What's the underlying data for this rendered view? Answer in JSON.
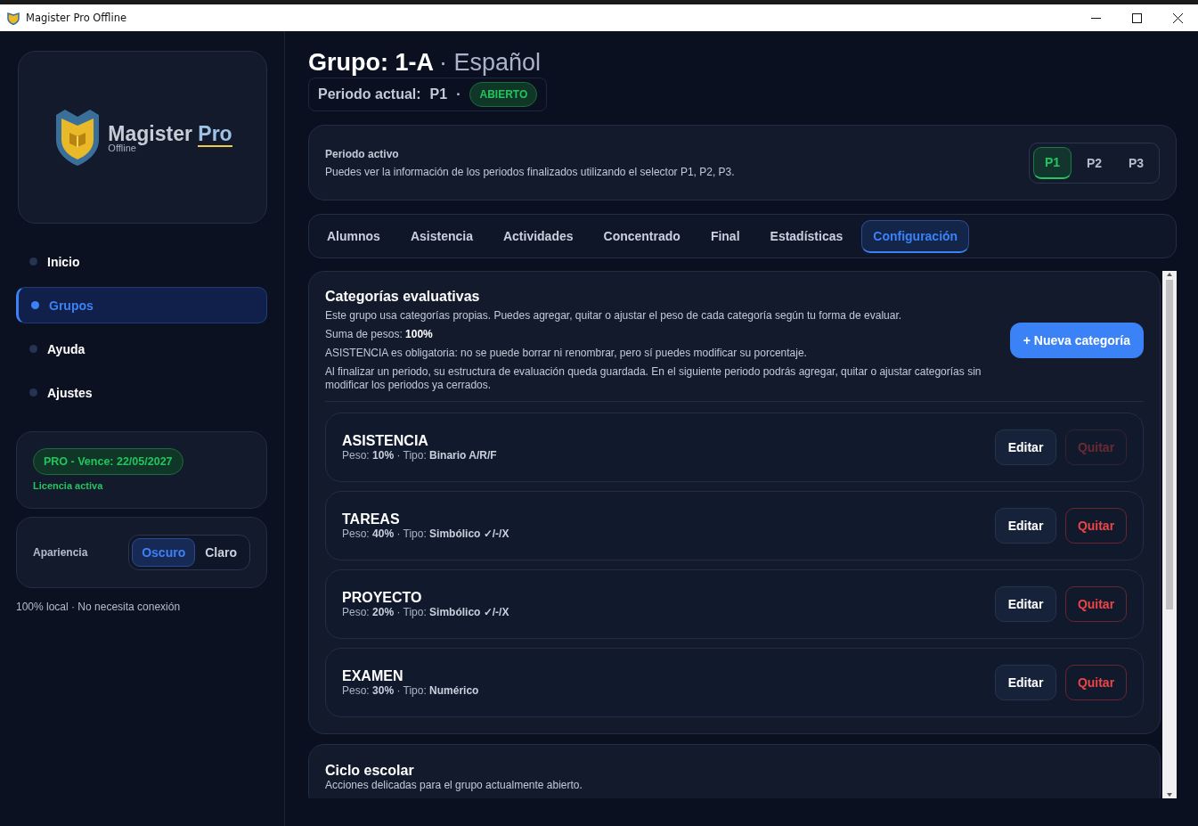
{
  "window": {
    "title": "Magister Pro Offline"
  },
  "sidebar": {
    "brand": {
      "name": "Magister",
      "accent": "Pro",
      "sub": "Offline"
    },
    "items": [
      {
        "label": "Inicio",
        "selected": false
      },
      {
        "label": "Grupos",
        "selected": true
      },
      {
        "label": "Ayuda",
        "selected": false
      },
      {
        "label": "Ajustes",
        "selected": false
      }
    ],
    "license": {
      "badge": "PRO - Vence: 22/05/2027",
      "status": "Licencia activa"
    },
    "appearance": {
      "label": "Apariencia",
      "options": [
        {
          "label": "Oscuro",
          "selected": true
        },
        {
          "label": "Claro",
          "selected": false
        }
      ]
    },
    "footer": "100% local · No necesita conexión"
  },
  "header": {
    "title": "Grupo: 1-A",
    "subject": "· Español",
    "period_label": "Periodo actual:",
    "period": "P1",
    "separator": "·",
    "status": "ABIERTO"
  },
  "period_card": {
    "title": "Periodo activo",
    "text": "Puedes ver la información de los periodos finalizados utilizando el selector P1, P2, P3.",
    "periods": [
      {
        "label": "P1",
        "selected": true
      },
      {
        "label": "P2",
        "selected": false
      },
      {
        "label": "P3",
        "selected": false
      }
    ]
  },
  "tabs": [
    {
      "label": "Alumnos",
      "selected": false
    },
    {
      "label": "Asistencia",
      "selected": false
    },
    {
      "label": "Actividades",
      "selected": false
    },
    {
      "label": "Concentrado",
      "selected": false
    },
    {
      "label": "Final",
      "selected": false
    },
    {
      "label": "Estadísticas",
      "selected": false
    },
    {
      "label": "Configuración",
      "selected": true
    }
  ],
  "categories_card": {
    "title": "Categorías evaluativas",
    "notes": [
      "Este grupo usa categorías propias. Puedes agregar, quitar o ajustar el peso de cada categoría según tu forma de evaluar.",
      "Suma de pesos: **100%**",
      "ASISTENCIA es obligatoria: no se puede borrar ni renombrar, pero sí puedes modificar su porcentaje.",
      "Al finalizar un periodo, su estructura de evaluación queda guardada. En el siguiente periodo podrás agregar, quitar o ajustar categorías sin modificar los periodos ya cerrados."
    ],
    "add_button": "+ Nueva categoría",
    "categories": [
      {
        "name": "ASISTENCIA",
        "detail": "Peso: **10%** · Tipo: **Binario A/R/F**",
        "edit": "Editar",
        "remove": "Quitar",
        "remove_disabled": true
      },
      {
        "name": "TAREAS",
        "detail": "Peso: **40%** · Tipo: **Simbólico ✓/-/X**",
        "edit": "Editar",
        "remove": "Quitar",
        "remove_disabled": false
      },
      {
        "name": "PROYECTO",
        "detail": "Peso: **20%** · Tipo: **Simbólico ✓/-/X**",
        "edit": "Editar",
        "remove": "Quitar",
        "remove_disabled": false
      },
      {
        "name": "EXAMEN",
        "detail": "Peso: **30%** · Tipo: **Numérico**",
        "edit": "Editar",
        "remove": "Quitar",
        "remove_disabled": false
      }
    ]
  },
  "cycle_card": {
    "title": "Ciclo escolar",
    "text": "Acciones delicadas para el grupo actualmente abierto."
  }
}
